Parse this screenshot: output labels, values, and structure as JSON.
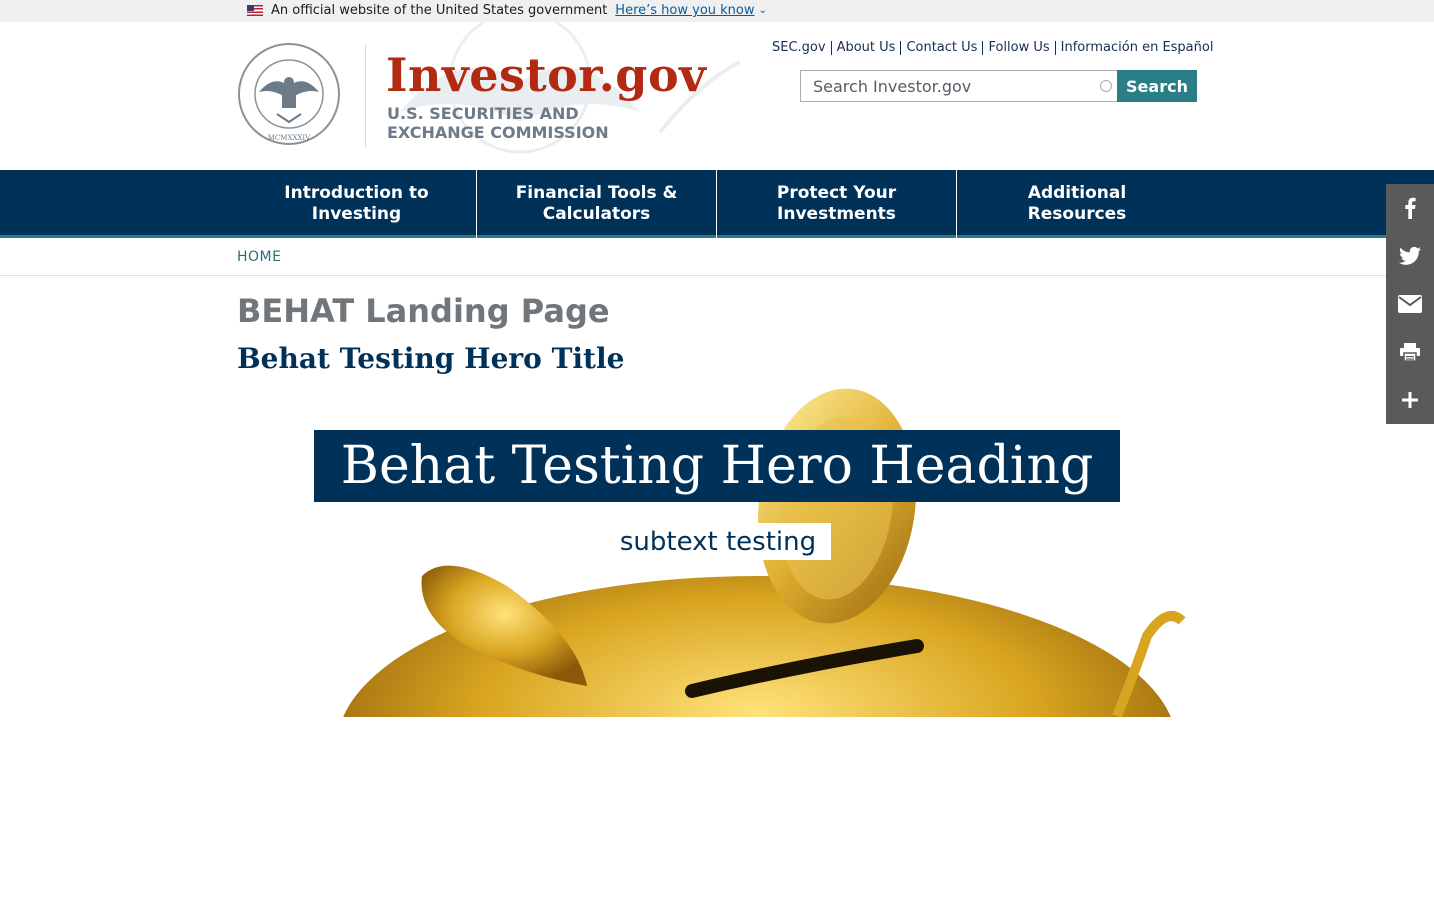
{
  "gov_banner": {
    "official_text": "An official website of the United States government",
    "how_link": "Here’s how you know"
  },
  "header": {
    "site_name": "Investor.gov",
    "agency_line1": "U.S. SECURITIES AND",
    "agency_line2": "EXCHANGE COMMISSION",
    "utility_links": [
      "SEC.gov",
      "About Us",
      "Contact Us",
      "Follow Us",
      "Información en Español"
    ],
    "search": {
      "placeholder": "Search Investor.gov",
      "button_label": "Search"
    }
  },
  "main_nav": {
    "items": [
      {
        "line1": "Introduction to",
        "line2": "Investing"
      },
      {
        "line1": "Financial Tools &",
        "line2": "Calculators"
      },
      {
        "line1": "Protect Your",
        "line2": "Investments"
      },
      {
        "line1": "Additional",
        "line2": "Resources"
      }
    ]
  },
  "breadcrumb": {
    "home": "HOME"
  },
  "page": {
    "title": "BEHAT Landing Page",
    "hero_title": "Behat Testing Hero Title",
    "hero_heading": "Behat Testing Hero Heading",
    "hero_subtext": "subtext testing"
  },
  "share_rail": {
    "icons": [
      "facebook-icon",
      "twitter-icon",
      "email-icon",
      "print-icon",
      "plus-icon"
    ]
  },
  "colors": {
    "brand_red": "#b22a12",
    "navy": "#003159",
    "teal": "#2a7f87",
    "gold": "#d9a520"
  }
}
